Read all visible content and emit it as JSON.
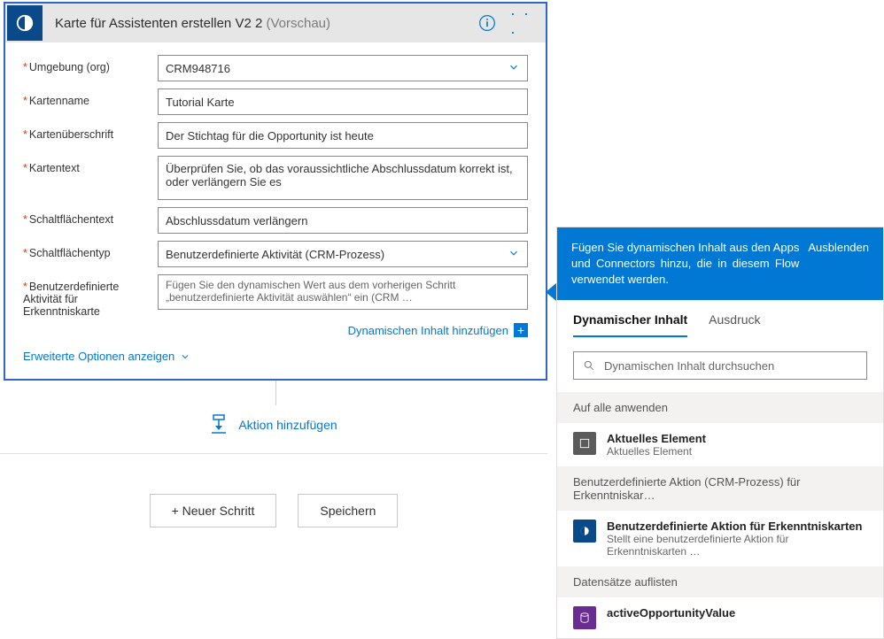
{
  "card": {
    "title": "Karte für Assistenten erstellen V2 2",
    "preview_label": "(Vorschau)",
    "fields": {
      "env_label": "Umgebung (org)",
      "env_value": "CRM948716",
      "name_label": "Kartenname",
      "name_value": "Tutorial Karte",
      "header_label": "Kartenüberschrift",
      "header_value": "Der Stichtag für die Opportunity ist heute",
      "text_label": "Kartentext",
      "text_value": "Überprüfen Sie, ob das voraussichtliche Abschlussdatum korrekt ist, oder verlängern Sie es",
      "btn_text_label": "Schaltflächentext",
      "btn_text_value": "Abschlussdatum verlängern",
      "btn_type_label": "Schaltflächentyp",
      "btn_type_value": "Benutzerdefinierte Aktivität (CRM-Prozess)",
      "custom_label": "Benutzerdefinierte Aktivität für Erkenntniskarte",
      "custom_placeholder": "Fügen Sie den dynamischen Wert aus dem vorherigen Schritt „benutzerdefinierte Aktivität auswählen“ ein (CRM …"
    },
    "dynamic_link": "Dynamischen Inhalt hinzufügen",
    "advanced": "Erweiterte Optionen anzeigen"
  },
  "add_action_label": "Aktion hinzufügen",
  "bottom": {
    "new_step": "+ Neuer Schritt",
    "save": "Speichern"
  },
  "right": {
    "banner_text": "Fügen Sie dynamischen Inhalt aus den Apps und Connectors hinzu, die in diesem Flow verwendet werden.",
    "hide_label": "Ausblenden",
    "tab_dynamic": "Dynamischer Inhalt",
    "tab_expression": "Ausdruck",
    "search_placeholder": "Dynamischen Inhalt durchsuchen",
    "sections": {
      "s1": "Auf alle anwenden",
      "s2": "Benutzerdefinierte Aktion (CRM-Prozess) für Erkenntniskar…",
      "s3": "Datensätze auflisten"
    },
    "items": {
      "i1_title": "Aktuelles Element",
      "i1_sub": "Aktuelles Element",
      "i2_title": "Benutzerdefinierte Aktion für Erkenntniskarten",
      "i2_sub": "Stellt eine benutzerdefinierte Aktion für Erkenntniskarten …",
      "i3_title": "activeOpportunityValue"
    }
  }
}
